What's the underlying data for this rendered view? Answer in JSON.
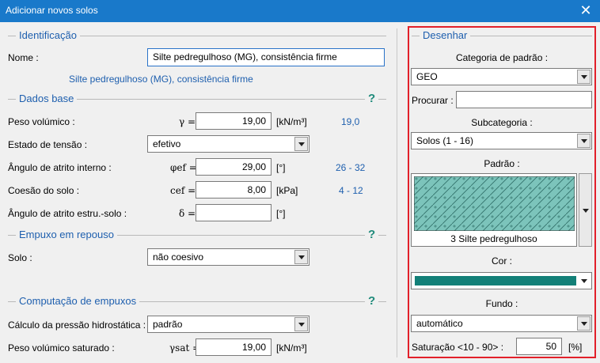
{
  "window": {
    "title": "Adicionar novos solos",
    "close_symbol": "✕"
  },
  "identificacao": {
    "title": "Identificação",
    "name_label": "Nome :",
    "name_value": "Silte pedregulhoso (MG), consistência firme",
    "name_preview": "Silte pedregulhoso (MG), consistência firme"
  },
  "dados_base": {
    "title": "Dados base",
    "help": "?",
    "peso_label": "Peso volúmico :",
    "peso_symbol": "γ =",
    "peso_value": "19,00",
    "peso_unit": "[kN/m³]",
    "peso_hint": "19,0",
    "estado_label": "Estado de tensão :",
    "estado_value": "efetivo",
    "atrito_label": "Ângulo de atrito interno :",
    "atrito_symbol": "φef =",
    "atrito_value": "29,00",
    "atrito_unit": "[°]",
    "atrito_hint": "26 - 32",
    "coesao_label": "Coesão do solo :",
    "coesao_symbol": "cef =",
    "coesao_value": "8,00",
    "coesao_unit": "[kPa]",
    "coesao_hint": "4 - 12",
    "estru_label": "Ângulo de atrito estru.-solo :",
    "estru_symbol": "δ =",
    "estru_value": "",
    "estru_unit": "[°]"
  },
  "empuxo_repouso": {
    "title": "Empuxo em repouso",
    "help": "?",
    "solo_label": "Solo :",
    "solo_value": "não coesivo"
  },
  "computacao": {
    "title": "Computação de empuxos",
    "help": "?",
    "pressao_label": "Cálculo da pressão hidrostática :",
    "pressao_value": "padrão",
    "sat_label": "Peso volúmico saturado :",
    "sat_symbol": "γsat =",
    "sat_value": "19,00",
    "sat_unit": "[kN/m³]"
  },
  "desenhar": {
    "title": "Desenhar",
    "categoria_label": "Categoria de padrão :",
    "categoria_value": "GEO",
    "procurar_label": "Procurar :",
    "procurar_value": "",
    "subcategoria_label": "Subcategoria :",
    "subcategoria_value": "Solos (1 - 16)",
    "padrao_label": "Padrão :",
    "padrao_name": "3 Silte pedregulhoso",
    "cor_label": "Cor :",
    "cor_color": "#138078",
    "fundo_label": "Fundo :",
    "fundo_value": "automático",
    "saturacao_label": "Saturação <10 - 90> :",
    "saturacao_value": "50",
    "saturacao_unit": "[%]"
  },
  "colors": {
    "title_bar": "#1979ca",
    "accent_text": "#1e5fae",
    "highlight_border": "#e2202a",
    "pattern_fill": "#7cc4bb"
  }
}
